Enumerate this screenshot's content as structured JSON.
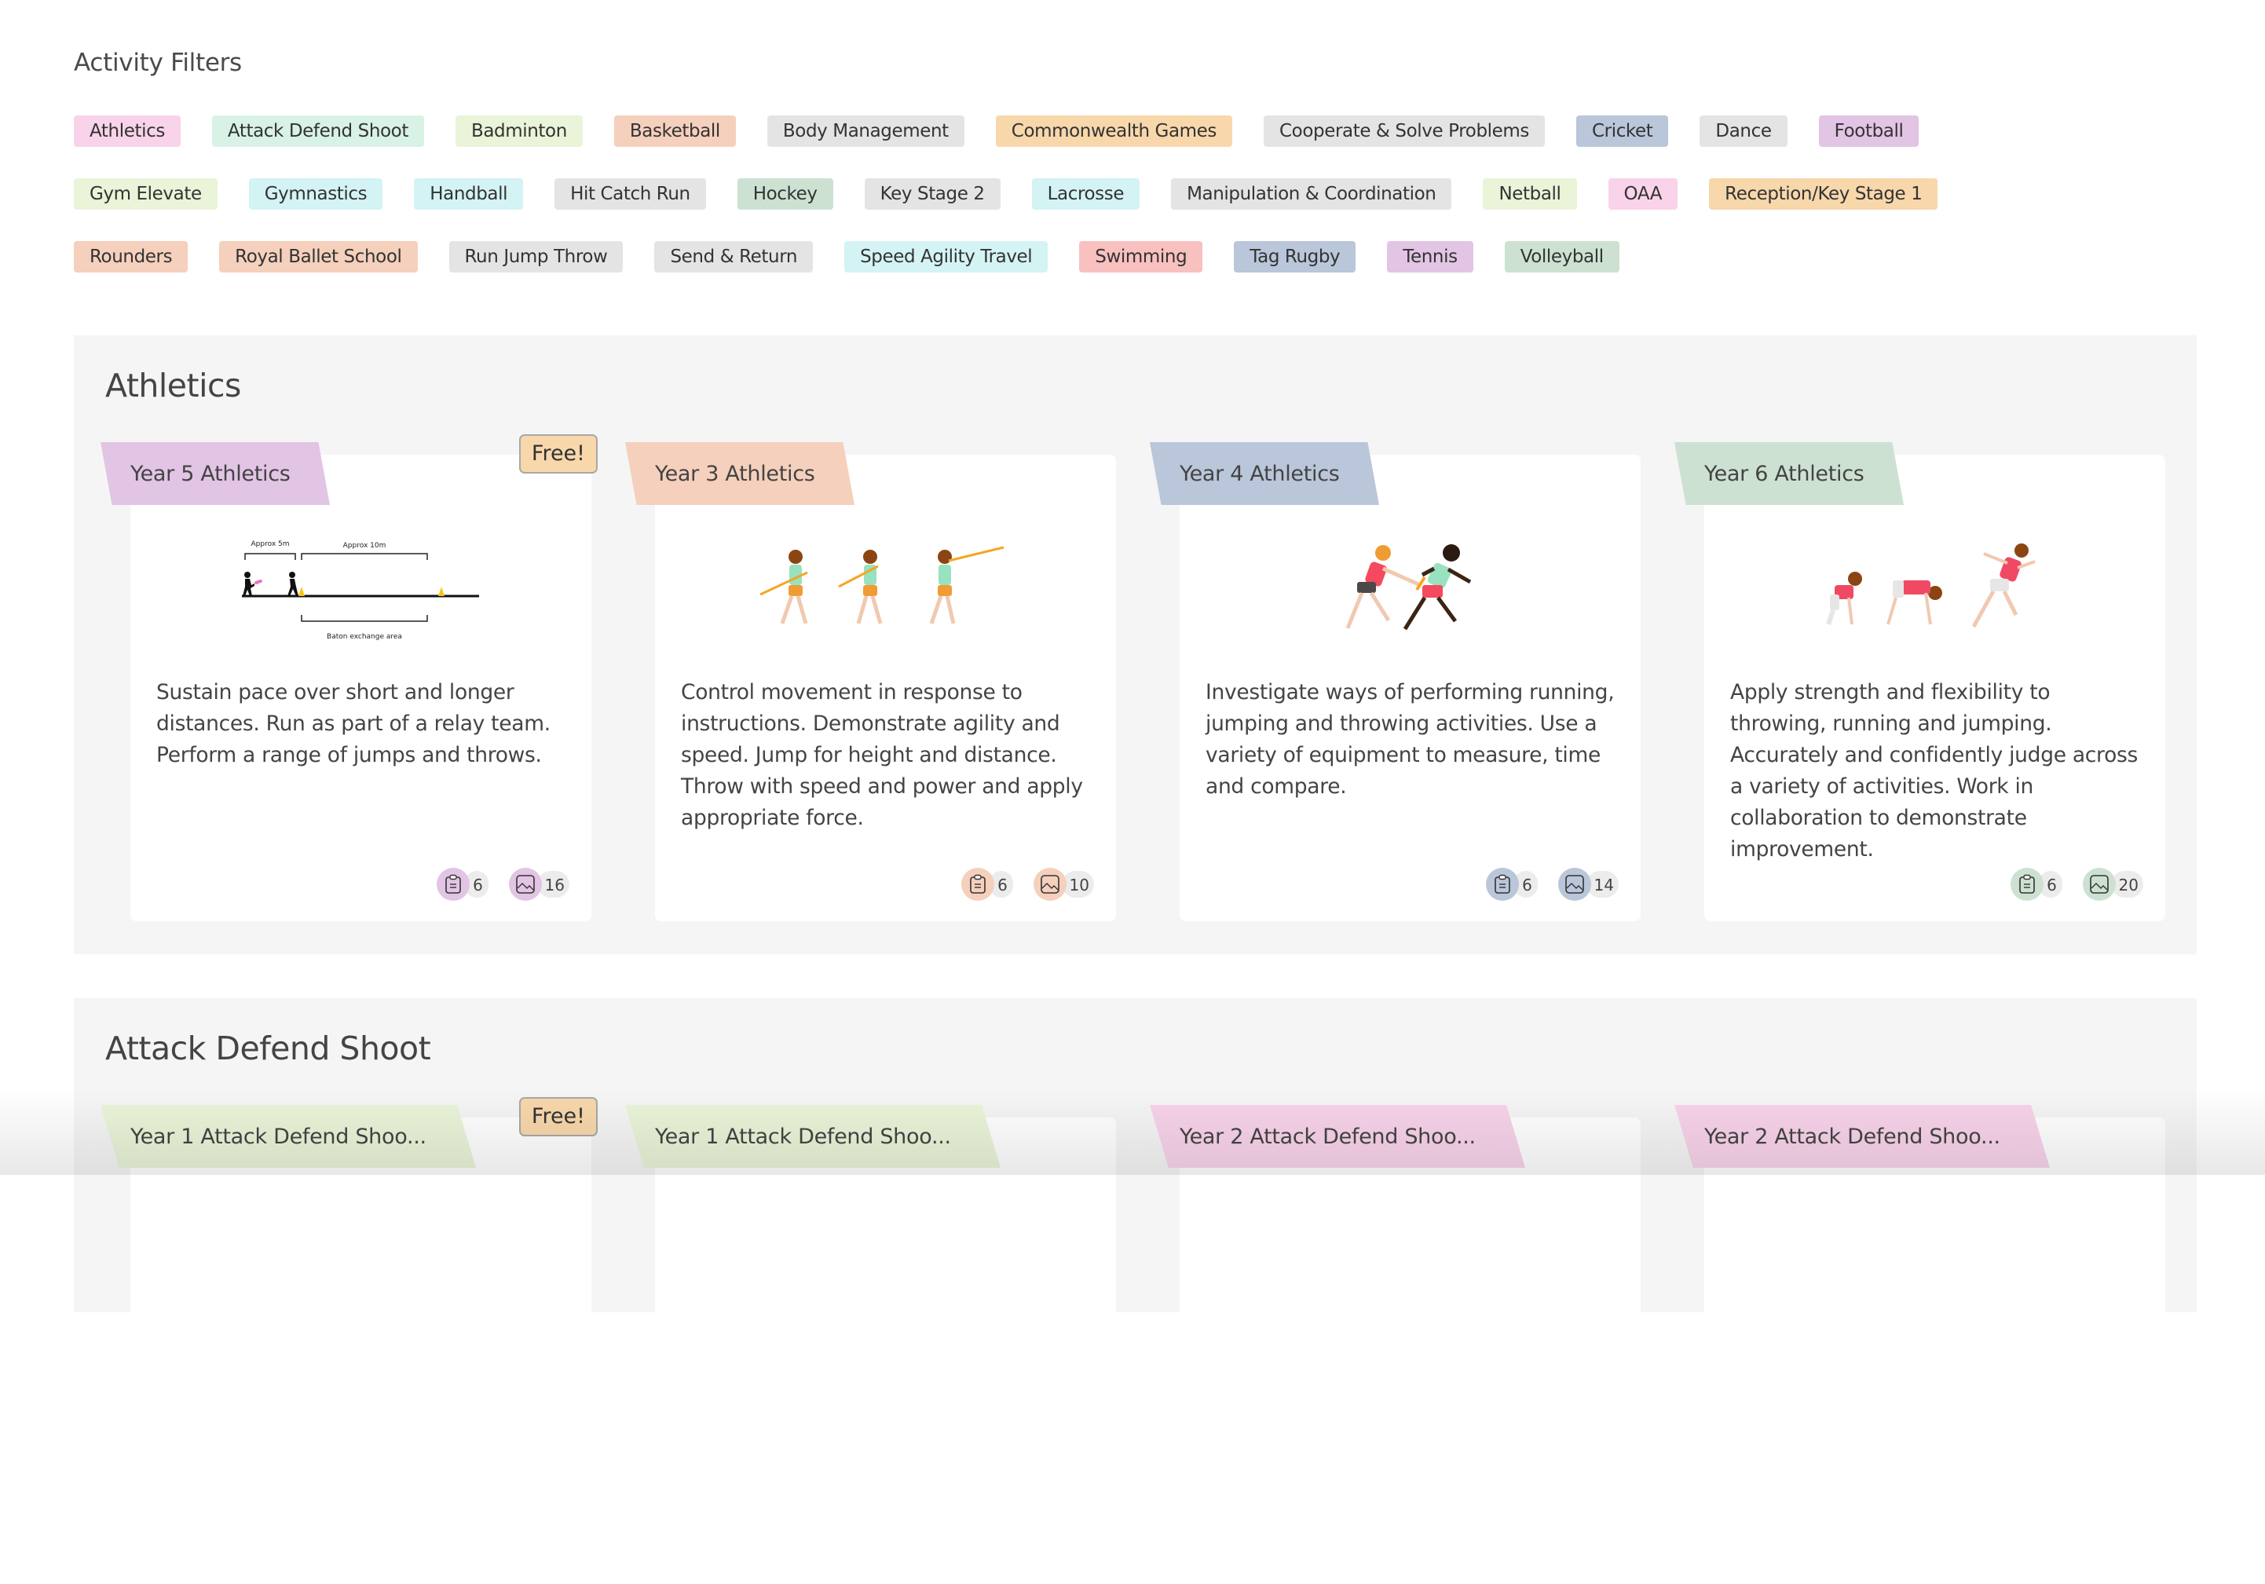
{
  "filters": {
    "title": "Activity Filters",
    "rows": [
      [
        {
          "label": "Athletics",
          "color": "#f8d3ea"
        },
        {
          "label": "Attack Defend Shoot",
          "color": "#d8f2e5"
        },
        {
          "label": "Badminton",
          "color": "#e9f4d8"
        },
        {
          "label": "Basketball",
          "color": "#f5d0bc"
        },
        {
          "label": "Body Management",
          "color": "#e4e4e4"
        },
        {
          "label": "Commonwealth Games",
          "color": "#f8d7ab"
        },
        {
          "label": "Cooperate & Solve Problems",
          "color": "#e4e4e4"
        },
        {
          "label": "Cricket",
          "color": "#bac6d9"
        },
        {
          "label": "Dance",
          "color": "#e4e4e4"
        },
        {
          "label": "Football",
          "color": "#e2c4e4"
        }
      ],
      [
        {
          "label": "Gym Elevate",
          "color": "#e9f4d8"
        },
        {
          "label": "Gymnastics",
          "color": "#d4f3f4"
        },
        {
          "label": "Handball",
          "color": "#d4f3f4"
        },
        {
          "label": "Hit Catch Run",
          "color": "#e4e4e4"
        },
        {
          "label": "Hockey",
          "color": "#cde1d2"
        },
        {
          "label": "Key Stage 2",
          "color": "#e4e4e4"
        },
        {
          "label": "Lacrosse",
          "color": "#d4f3f4"
        },
        {
          "label": "Manipulation & Coordination",
          "color": "#e4e4e4"
        },
        {
          "label": "Netball",
          "color": "#e9f4d8"
        },
        {
          "label": "OAA",
          "color": "#f8d3ea"
        },
        {
          "label": "Reception/Key Stage 1",
          "color": "#f8d7ab"
        }
      ],
      [
        {
          "label": "Rounders",
          "color": "#f5d0bc"
        },
        {
          "label": "Royal Ballet School",
          "color": "#f5d0bc"
        },
        {
          "label": "Run Jump Throw",
          "color": "#e4e4e4"
        },
        {
          "label": "Send & Return",
          "color": "#e4e4e4"
        },
        {
          "label": "Speed Agility Travel",
          "color": "#d4f3f4"
        },
        {
          "label": "Swimming",
          "color": "#f9c0c0"
        },
        {
          "label": "Tag Rugby",
          "color": "#bac6d9"
        },
        {
          "label": "Tennis",
          "color": "#e2c4e4"
        },
        {
          "label": "Volleyball",
          "color": "#cde1d2"
        }
      ]
    ]
  },
  "sections": [
    {
      "title": "Athletics",
      "cards": [
        {
          "title": "Year 5 Athletics",
          "tag_color": "#e2c4e4",
          "free": "Free!",
          "illustration": "relay-baton-exchange-diagram",
          "diagram_labels": {
            "top_left": "Approx 5m",
            "top_right": "Approx 10m",
            "bottom": "Baton exchange area"
          },
          "description": "Sustain pace over short and longer distances. Run as part of a relay team. Perform a range of jumps and throws.",
          "lesson_count": "6",
          "media_count": "16"
        },
        {
          "title": "Year 3 Athletics",
          "tag_color": "#f5d0bc",
          "illustration": "javelin-throw-sequence",
          "description": "Control movement in response to instructions. Demonstrate agility and speed. Jump for height and distance. Throw with speed and power and apply appropriate force.",
          "lesson_count": "6",
          "media_count": "10"
        },
        {
          "title": "Year 4 Athletics",
          "tag_color": "#bac6d9",
          "illustration": "relay-runners",
          "description": "Investigate ways of performing running, jumping and throwing activities. Use a variety of equipment to measure, time and compare.",
          "lesson_count": "6",
          "media_count": "14"
        },
        {
          "title": "Year 6 Athletics",
          "tag_color": "#cde1d2",
          "illustration": "sprint-start-sequence",
          "description": "Apply strength and flexibility to throwing, running and jumping. Accurately and confidently judge across a variety of activities. Work in collaboration to demonstrate improvement.",
          "lesson_count": "6",
          "media_count": "20"
        }
      ]
    },
    {
      "title": "Attack Defend Shoot",
      "cards": [
        {
          "title": "Year 1 Attack Defend Shoo...",
          "tag_color": "#e9f4d8",
          "free": "Free!"
        },
        {
          "title": "Year 1 Attack Defend Shoo...",
          "tag_color": "#e9f4d8"
        },
        {
          "title": "Year 2 Attack Defend Shoo...",
          "tag_color": "#f8d3ea"
        },
        {
          "title": "Year 2 Attack Defend Shoo...",
          "tag_color": "#f8d3ea"
        }
      ]
    }
  ]
}
